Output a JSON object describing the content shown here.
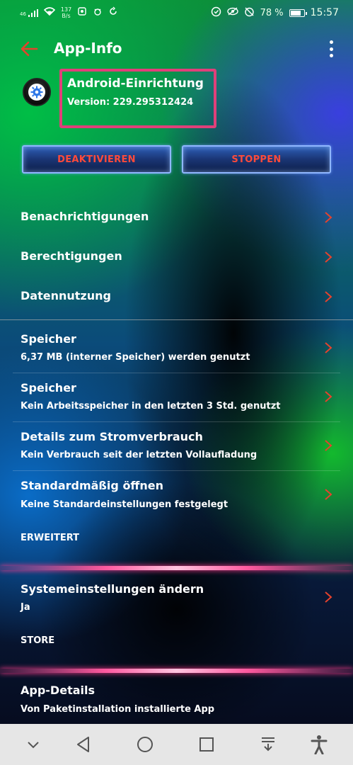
{
  "status_bar": {
    "signal": "46",
    "net_speed_value": "137",
    "net_speed_unit": "B/s",
    "battery": "78 %",
    "time": "15:57"
  },
  "app_bar": {
    "title": "App-Info",
    "back_icon": "arrow-left-icon",
    "more_icon": "more-vert-icon"
  },
  "app": {
    "name": "Android-Einrichtung",
    "version": "Version: 229.295312424",
    "icon": "gear-icon"
  },
  "actions": {
    "deactivate_label": "DEAKTIVIEREN",
    "stop_label": "STOPPEN"
  },
  "menu": [
    {
      "title": "Benachrichtigungen"
    },
    {
      "title": "Berechtigungen"
    },
    {
      "title": "Datennutzung"
    }
  ],
  "details": [
    {
      "title": "Speicher",
      "subtitle": "6,37 MB (interner Speicher) werden genutzt"
    },
    {
      "title": "Speicher",
      "subtitle": "Kein Arbeitsspeicher in den letzten 3 Std. genutzt"
    },
    {
      "title": "Details zum Stromverbrauch",
      "subtitle": "Kein Verbrauch seit der letzten Vollaufladung"
    },
    {
      "title": "Standardmäßig öffnen",
      "subtitle": "Keine Standardeinstellungen festgelegt"
    }
  ],
  "advanced": {
    "label": "ERWEITERT",
    "items": [
      {
        "title": "Systemeinstellungen ändern",
        "subtitle": "Ja"
      }
    ]
  },
  "store": {
    "label": "STORE",
    "items": [
      {
        "title": "App-Details",
        "subtitle": "Von Paketinstallation installierte App"
      }
    ]
  },
  "colors": {
    "accent": "#ff4a3a",
    "highlight_box": "#e0407a",
    "chevron": "#ff4a3a"
  },
  "nav_bar": {
    "icons": [
      "chevron-down-icon",
      "back-triangle-icon",
      "home-circle-icon",
      "recents-square-icon",
      "download-tray-icon",
      "accessibility-icon"
    ]
  }
}
